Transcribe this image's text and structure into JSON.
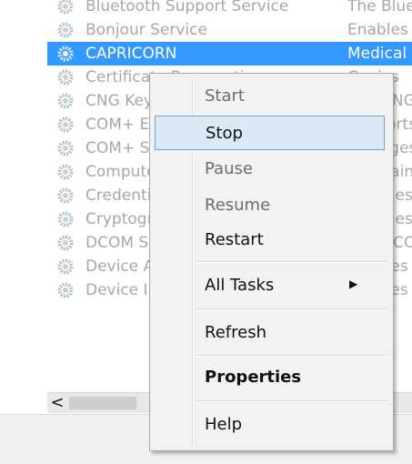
{
  "services": [
    {
      "name": "Bluetooth Support Service",
      "description": "The Bluetooth",
      "selected": false
    },
    {
      "name": "Bonjour Service",
      "description": "Enables",
      "selected": false
    },
    {
      "name": "CAPRICORN",
      "description": "Medical",
      "selected": true
    },
    {
      "name": "Certificate Propagation",
      "description": "Copies",
      "selected": false
    },
    {
      "name": "CNG Key Isolation",
      "description": "The CNG",
      "selected": false
    },
    {
      "name": "COM+ Event System",
      "description": "Supports",
      "selected": false
    },
    {
      "name": "COM+ System Application",
      "description": "Manages",
      "selected": false
    },
    {
      "name": "Computer Browser",
      "description": "Maintains",
      "selected": false
    },
    {
      "name": "Credential Manager",
      "description": "Provides",
      "selected": false
    },
    {
      "name": "Cryptographic Services",
      "description": "Provides",
      "selected": false
    },
    {
      "name": "DCOM Server Process Launcher",
      "description": "The DCOM",
      "selected": false
    },
    {
      "name": "Device Association Service",
      "description": "Enables",
      "selected": false
    },
    {
      "name": "Device Install Service",
      "description": "Enables",
      "selected": false
    }
  ],
  "context_menu": {
    "items": [
      {
        "label": "Start",
        "state": "disabled"
      },
      {
        "label": "Stop",
        "state": "hover"
      },
      {
        "label": "Pause",
        "state": "disabled"
      },
      {
        "label": "Resume",
        "state": "disabled"
      },
      {
        "label": "Restart",
        "state": "normal"
      },
      {
        "label": "All Tasks",
        "state": "submenu"
      },
      {
        "label": "Refresh",
        "state": "normal"
      },
      {
        "label": "Properties",
        "state": "bold"
      },
      {
        "label": "Help",
        "state": "normal"
      }
    ],
    "submenu_arrow": "▶"
  },
  "scrollbar": {
    "left_arrow": "<"
  },
  "icons": {
    "service_gear": "gear-icon",
    "scroll_left": "chevron-left-icon",
    "submenu": "chevron-right-icon"
  },
  "colors": {
    "selection": "#3399ff",
    "menu_hover": "#dde8f6",
    "menu_hover_border": "#74a3d4"
  }
}
